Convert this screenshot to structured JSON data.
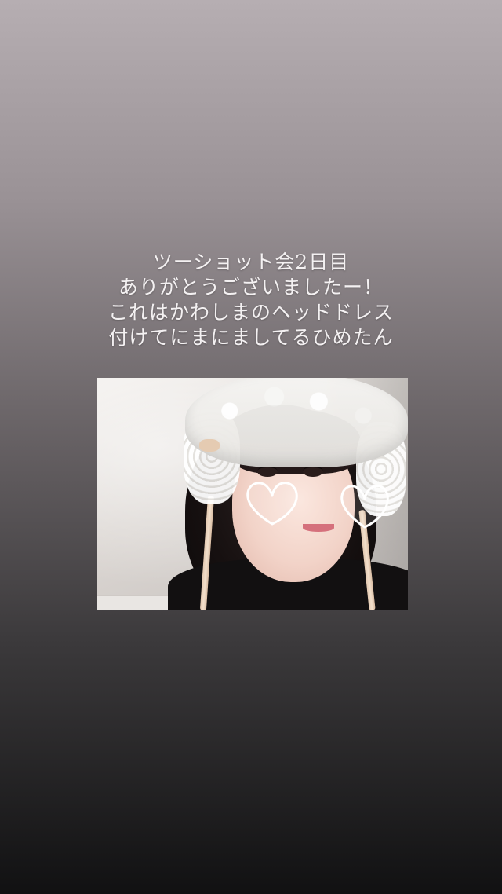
{
  "story": {
    "caption_lines": [
      "ツーショット会2日目",
      "ありがとうございましたー！",
      "これはかわしまのヘッドドレス",
      "付けてにまにましてるひめたん"
    ]
  },
  "photo": {
    "description_icon": "selfie-photo",
    "sticker_icon": "heart-sticker-icon",
    "colors": {
      "hair": "#161010",
      "lace": "#f6f5f3",
      "sweater": "#121011",
      "ribbon": "#e2c8b0"
    }
  }
}
